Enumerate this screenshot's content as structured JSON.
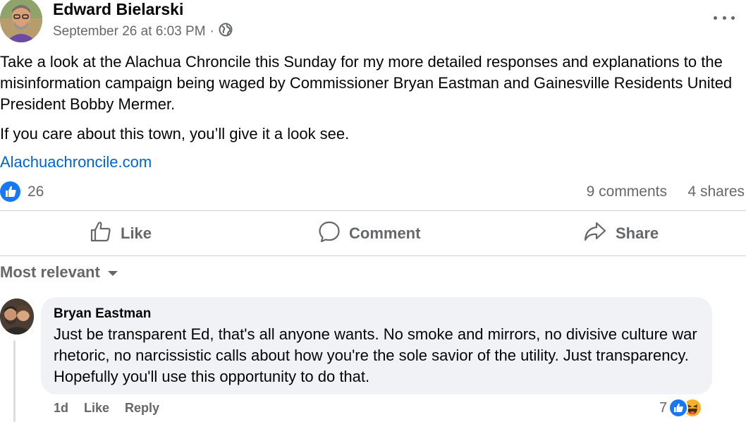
{
  "post": {
    "author": "Edward Bielarski",
    "timestamp": "September 26 at 6:03 PM",
    "separator": "·",
    "privacy_icon": "globe-icon",
    "more_icon": "more-dots-icon",
    "paragraph1": "Take a look at the Alachua Chroncile this Sunday for my more detailed responses and explanations to the misinformation campaign being waged by Commissioner Bryan Eastman and Gainesville Residents United President Bobby Mermer.",
    "paragraph2": "If you care about this town, you’ll give it a look see.",
    "link": "Alachuachroncile.com",
    "reaction_count": "26",
    "comments_count": "9 comments",
    "shares_count": "4 shares"
  },
  "actions": {
    "like": "Like",
    "comment": "Comment",
    "share": "Share"
  },
  "sort": {
    "label": "Most relevant"
  },
  "comment": {
    "author": "Bryan Eastman",
    "text": "Just be transparent Ed, that's all anyone wants. No smoke and mirrors, no divisive culture war rhetoric, no narcissistic calls about how you're the sole savior of the utility. Just transparency. Hopefully you'll use this opportunity to do that.",
    "time": "1d",
    "like_label": "Like",
    "reply_label": "Reply",
    "reaction_count": "7"
  },
  "colors": {
    "brand_blue": "#1877f2",
    "link_blue": "#0064d1",
    "secondary_text": "#65676b",
    "bubble_bg": "#f0f2f5"
  }
}
